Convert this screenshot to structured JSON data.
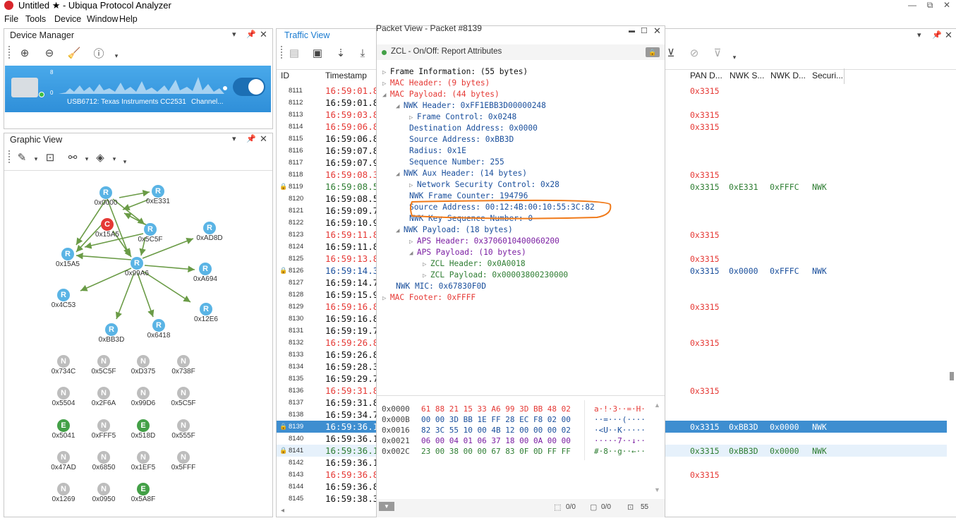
{
  "window": {
    "title": "Untitled ★ - Ubiqua Protocol Analyzer",
    "controls": [
      "—",
      "⧉",
      "✕"
    ]
  },
  "menu": [
    "File",
    "Tools",
    "Device",
    "Window",
    "Help"
  ],
  "device_manager": {
    "title": "Device Manager",
    "device_name": "USB6712: Texas Instruments CC2531",
    "channel": "Channel...",
    "scale_top": "8",
    "scale_bottom": "0"
  },
  "graphic_view": {
    "title": "Graphic View",
    "nodes": [
      {
        "type": "R",
        "label": "0x0000"
      },
      {
        "type": "R",
        "label": "0xE331"
      },
      {
        "type": "C",
        "label": "0x15A5"
      },
      {
        "type": "R",
        "label": "0x5C5F"
      },
      {
        "type": "R",
        "label": "0xAD8D"
      },
      {
        "type": "R",
        "label": "0x15A5"
      },
      {
        "type": "R",
        "label": "0x99A6"
      },
      {
        "type": "R",
        "label": "0xA694"
      },
      {
        "type": "R",
        "label": "0x4C53"
      },
      {
        "type": "R",
        "label": "0x12E6"
      },
      {
        "type": "R",
        "label": "0xBB3D"
      },
      {
        "type": "R",
        "label": "0x6418"
      },
      {
        "type": "N",
        "label": "0x734C"
      },
      {
        "type": "N",
        "label": "0x5C5F"
      },
      {
        "type": "N",
        "label": "0xD375"
      },
      {
        "type": "N",
        "label": "0x738F"
      },
      {
        "type": "N",
        "label": "0x5504"
      },
      {
        "type": "N",
        "label": "0x2F6A"
      },
      {
        "type": "N",
        "label": "0x99D6"
      },
      {
        "type": "N",
        "label": "0x5C5F"
      },
      {
        "type": "E",
        "label": "0x5041"
      },
      {
        "type": "N",
        "label": "0xFFF5"
      },
      {
        "type": "E",
        "label": "0x518D"
      },
      {
        "type": "N",
        "label": "0x555F"
      },
      {
        "type": "N",
        "label": "0x47AD"
      },
      {
        "type": "N",
        "label": "0x6850"
      },
      {
        "type": "N",
        "label": "0x1EF5"
      },
      {
        "type": "N",
        "label": "0x5FFF"
      },
      {
        "type": "N",
        "label": "0x1269"
      },
      {
        "type": "N",
        "label": "0x0950"
      },
      {
        "type": "E",
        "label": "0x5A8F"
      }
    ]
  },
  "traffic_view": {
    "title": "Traffic View",
    "columns": {
      "id": "ID",
      "timestamp": "Timestamp",
      "pan": "PAN D...",
      "nwks": "NWK S...",
      "nwkd": "NWK D...",
      "security": "Securi..."
    },
    "rows": [
      {
        "id": "8111",
        "ts": "16:59:01.8",
        "c": "red",
        "pan": "0x3315",
        "ns": "",
        "nd": "",
        "sec": "",
        "lock": false
      },
      {
        "id": "8112",
        "ts": "16:59:01.8",
        "c": "black",
        "pan": "",
        "ns": "",
        "nd": "",
        "sec": "",
        "lock": false
      },
      {
        "id": "8113",
        "ts": "16:59:03.8",
        "c": "red",
        "pan": "0x3315",
        "ns": "",
        "nd": "",
        "sec": "",
        "lock": false
      },
      {
        "id": "8114",
        "ts": "16:59:06.8",
        "c": "red",
        "pan": "0x3315",
        "ns": "",
        "nd": "",
        "sec": "",
        "lock": false
      },
      {
        "id": "8115",
        "ts": "16:59:06.8",
        "c": "black",
        "pan": "",
        "ns": "",
        "nd": "",
        "sec": "",
        "lock": false
      },
      {
        "id": "8116",
        "ts": "16:59:07.8",
        "c": "black",
        "pan": "",
        "ns": "",
        "nd": "",
        "sec": "",
        "lock": false
      },
      {
        "id": "8117",
        "ts": "16:59:07.9",
        "c": "black",
        "pan": "",
        "ns": "",
        "nd": "",
        "sec": "",
        "lock": false
      },
      {
        "id": "8118",
        "ts": "16:59:08.3",
        "c": "red",
        "pan": "0x3315",
        "ns": "",
        "nd": "",
        "sec": "",
        "lock": false
      },
      {
        "id": "8119",
        "ts": "16:59:08.5",
        "c": "green",
        "pan": "0x3315",
        "ns": "0xE331",
        "nd": "0xFFFC",
        "sec": "NWK",
        "lock": true
      },
      {
        "id": "8120",
        "ts": "16:59:08.5",
        "c": "black",
        "pan": "",
        "ns": "",
        "nd": "",
        "sec": "",
        "lock": false
      },
      {
        "id": "8121",
        "ts": "16:59:09.7",
        "c": "black",
        "pan": "",
        "ns": "",
        "nd": "",
        "sec": "",
        "lock": false
      },
      {
        "id": "8122",
        "ts": "16:59:10.9",
        "c": "black",
        "pan": "",
        "ns": "",
        "nd": "",
        "sec": "",
        "lock": false
      },
      {
        "id": "8123",
        "ts": "16:59:11.8",
        "c": "red",
        "pan": "0x3315",
        "ns": "",
        "nd": "",
        "sec": "",
        "lock": false
      },
      {
        "id": "8124",
        "ts": "16:59:11.8",
        "c": "black",
        "pan": "",
        "ns": "",
        "nd": "",
        "sec": "",
        "lock": false
      },
      {
        "id": "8125",
        "ts": "16:59:13.8",
        "c": "red",
        "pan": "0x3315",
        "ns": "",
        "nd": "",
        "sec": "",
        "lock": false
      },
      {
        "id": "8126",
        "ts": "16:59:14.3",
        "c": "blue",
        "pan": "0x3315",
        "ns": "0x0000",
        "nd": "0xFFFC",
        "sec": "NWK",
        "lock": true
      },
      {
        "id": "8127",
        "ts": "16:59:14.7",
        "c": "black",
        "pan": "",
        "ns": "",
        "nd": "",
        "sec": "",
        "lock": false
      },
      {
        "id": "8128",
        "ts": "16:59:15.9",
        "c": "black",
        "pan": "",
        "ns": "",
        "nd": "",
        "sec": "",
        "lock": false
      },
      {
        "id": "8129",
        "ts": "16:59:16.8",
        "c": "red",
        "pan": "0x3315",
        "ns": "",
        "nd": "",
        "sec": "",
        "lock": false
      },
      {
        "id": "8130",
        "ts": "16:59:16.8",
        "c": "black",
        "pan": "",
        "ns": "",
        "nd": "",
        "sec": "",
        "lock": false
      },
      {
        "id": "8131",
        "ts": "16:59:19.7",
        "c": "black",
        "pan": "",
        "ns": "",
        "nd": "",
        "sec": "",
        "lock": false
      },
      {
        "id": "8132",
        "ts": "16:59:26.8",
        "c": "red",
        "pan": "0x3315",
        "ns": "",
        "nd": "",
        "sec": "",
        "lock": false
      },
      {
        "id": "8133",
        "ts": "16:59:26.8",
        "c": "black",
        "pan": "",
        "ns": "",
        "nd": "",
        "sec": "",
        "lock": false
      },
      {
        "id": "8134",
        "ts": "16:59:28.3",
        "c": "black",
        "pan": "",
        "ns": "",
        "nd": "",
        "sec": "",
        "lock": false
      },
      {
        "id": "8135",
        "ts": "16:59:29.7",
        "c": "black",
        "pan": "",
        "ns": "",
        "nd": "",
        "sec": "",
        "lock": false
      },
      {
        "id": "8136",
        "ts": "16:59:31.8",
        "c": "red",
        "pan": "0x3315",
        "ns": "",
        "nd": "",
        "sec": "",
        "lock": false
      },
      {
        "id": "8137",
        "ts": "16:59:31.8",
        "c": "black",
        "pan": "",
        "ns": "",
        "nd": "",
        "sec": "",
        "lock": false
      },
      {
        "id": "8138",
        "ts": "16:59:34.7",
        "c": "black",
        "pan": "",
        "ns": "",
        "nd": "",
        "sec": "",
        "lock": false
      },
      {
        "id": "8139",
        "ts": "16:59:36.1",
        "c": "black",
        "pan": "0x3315",
        "ns": "0xBB3D",
        "nd": "0x0000",
        "sec": "NWK",
        "lock": true,
        "selected": true
      },
      {
        "id": "8140",
        "ts": "16:59:36.1",
        "c": "black",
        "pan": "",
        "ns": "",
        "nd": "",
        "sec": "",
        "lock": false
      },
      {
        "id": "8141",
        "ts": "16:59:36.1",
        "c": "green",
        "pan": "0x3315",
        "ns": "0xBB3D",
        "nd": "0x0000",
        "sec": "NWK",
        "lock": true,
        "highlight": true
      },
      {
        "id": "8142",
        "ts": "16:59:36.1",
        "c": "black",
        "pan": "",
        "ns": "",
        "nd": "",
        "sec": "",
        "lock": false
      },
      {
        "id": "8143",
        "ts": "16:59:36.8",
        "c": "red",
        "pan": "0x3315",
        "ns": "",
        "nd": "",
        "sec": "",
        "lock": false
      },
      {
        "id": "8144",
        "ts": "16:59:36.8",
        "c": "black",
        "pan": "",
        "ns": "",
        "nd": "",
        "sec": "",
        "lock": false
      },
      {
        "id": "8145",
        "ts": "16:59:38.3",
        "c": "black",
        "pan": "",
        "ns": "",
        "nd": "",
        "sec": "",
        "lock": false
      }
    ]
  },
  "packet_view": {
    "title": "Packet View - Packet #8139",
    "summary": "ZCL - On/Off: Report Attributes",
    "tree": [
      {
        "text": "Frame Information: (55 bytes)",
        "indent": 0,
        "c": "black",
        "tri": "▷"
      },
      {
        "text": "MAC Header: (9 bytes)",
        "indent": 0,
        "c": "red",
        "tri": "▷"
      },
      {
        "text": "MAC Payload: (44 bytes)",
        "indent": 0,
        "c": "red",
        "tri": "◢"
      },
      {
        "text": "NWK Header: 0xFF1EBB3D00000248",
        "indent": 1,
        "c": "blue",
        "tri": "◢"
      },
      {
        "text": "Frame Control: 0x0248",
        "indent": 2,
        "c": "blue",
        "tri": "▷"
      },
      {
        "text": "Destination Address: 0x0000",
        "indent": 2,
        "c": "blue",
        "tri": ""
      },
      {
        "text": "Source Address: 0xBB3D",
        "indent": 2,
        "c": "blue",
        "tri": ""
      },
      {
        "text": "Radius: 0x1E",
        "indent": 2,
        "c": "blue",
        "tri": ""
      },
      {
        "text": "Sequence Number: 255",
        "indent": 2,
        "c": "blue",
        "tri": ""
      },
      {
        "text": "NWK Aux Header: (14 bytes)",
        "indent": 1,
        "c": "blue",
        "tri": "◢"
      },
      {
        "text": "Network Security Control: 0x28",
        "indent": 2,
        "c": "blue",
        "tri": "▷"
      },
      {
        "text": "NWK Frame Counter: 194796",
        "indent": 2,
        "c": "blue",
        "tri": ""
      },
      {
        "text": "Source Address: 00:12:4B:00:10:55:3C:82",
        "indent": 2,
        "c": "blue",
        "tri": "",
        "circled": true
      },
      {
        "text": "NWK Key Sequence Number: 0",
        "indent": 2,
        "c": "blue",
        "tri": ""
      },
      {
        "text": "NWK Payload: (18 bytes)",
        "indent": 1,
        "c": "blue",
        "tri": "◢"
      },
      {
        "text": "APS Header: 0x3706010400060200",
        "indent": 2,
        "c": "purple",
        "tri": "▷"
      },
      {
        "text": "APS Payload: (10 bytes)",
        "indent": 2,
        "c": "purple",
        "tri": "◢"
      },
      {
        "text": "ZCL Header: 0x0A0018",
        "indent": 3,
        "c": "green",
        "tri": "▷"
      },
      {
        "text": "ZCL Payload: 0x00003800230000",
        "indent": 3,
        "c": "green",
        "tri": "▷"
      },
      {
        "text": "NWK MIC: 0x67830F0D",
        "indent": 1,
        "c": "blue",
        "tri": ""
      },
      {
        "text": "MAC Footer: 0xFFFF",
        "indent": 0,
        "c": "red",
        "tri": "▷"
      }
    ],
    "hex": [
      {
        "off": "0x0000",
        "bytes": "61 88 21 15 33 A6 99 3D BB 48 02",
        "ascii": "a·!·3··=·H·",
        "c": "red"
      },
      {
        "off": "0x000B",
        "bytes": "00 00 3D BB 1E FF 28 EC F8 02 00",
        "ascii": "··=···(····",
        "c": "blue"
      },
      {
        "off": "0x0016",
        "bytes": "82 3C 55 10 00 4B 12 00 00 00 02",
        "ascii": "·<U··K·····",
        "c": "blue"
      },
      {
        "off": "0x0021",
        "bytes": "06 00 04 01 06 37 18 00 0A 00 00",
        "ascii": "·····7··↓··",
        "c": "purple"
      },
      {
        "off": "0x002C",
        "bytes": "23 00 38 00 00 67 83 0F 0D FF FF",
        "ascii": "#·8··g··←··",
        "c": "green"
      }
    ],
    "status": {
      "a": "0/0",
      "b": "0/0",
      "c": "55"
    }
  },
  "colors": {
    "accent": "#3e8ed0",
    "red": "#e53935",
    "green": "#2e7d32",
    "blue": "#1a4f9c",
    "purple": "#7b1fa2",
    "orange": "#f07a1a"
  }
}
